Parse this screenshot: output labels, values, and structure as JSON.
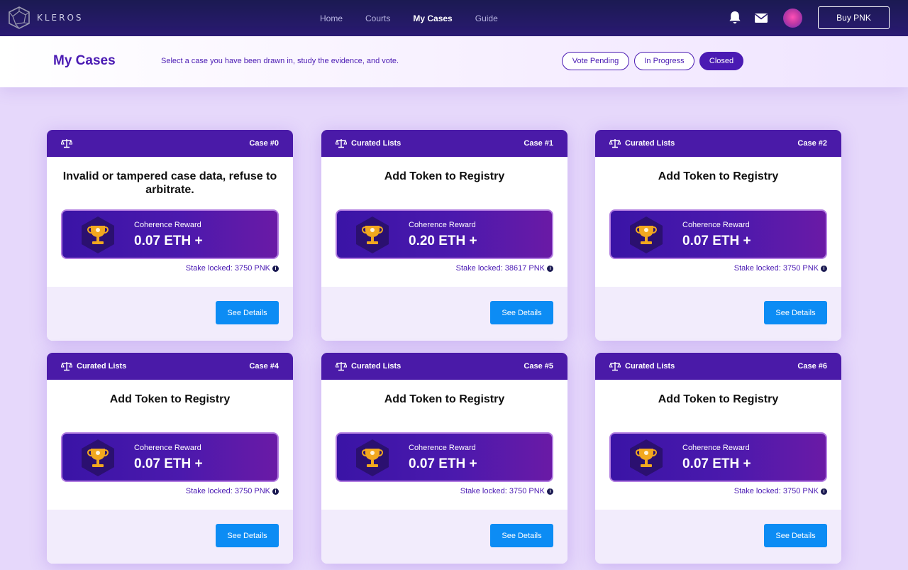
{
  "nav": {
    "logo_text": "KLEROS",
    "links": [
      "Home",
      "Courts",
      "My Cases",
      "Guide"
    ],
    "active": "My Cases",
    "buy_label": "Buy PNK"
  },
  "header": {
    "title": "My Cases",
    "subtitle": "Select a case you have been drawn in, study the evidence, and vote.",
    "filters": [
      "Vote Pending",
      "In Progress",
      "Closed"
    ],
    "active_filter": "Closed"
  },
  "colors": {
    "brand": "#4a1ab3",
    "nav_bg": "#1b1a52",
    "button": "#0c8cf4",
    "trophy": "#f2a81f"
  },
  "cards": [
    {
      "category": "",
      "case": "Case #0",
      "title": "Invalid or tampered case data, refuse to arbitrate.",
      "reward_label": "Coherence Reward",
      "reward": "0.07 ETH +",
      "stake": "Stake locked: 3750 PNK",
      "button": "See Details"
    },
    {
      "category": "Curated Lists",
      "case": "Case #1",
      "title": "Add Token to Registry",
      "reward_label": "Coherence Reward",
      "reward": "0.20 ETH +",
      "stake": "Stake locked: 38617 PNK",
      "button": "See Details"
    },
    {
      "category": "Curated Lists",
      "case": "Case #2",
      "title": "Add Token to Registry",
      "reward_label": "Coherence Reward",
      "reward": "0.07 ETH +",
      "stake": "Stake locked: 3750 PNK",
      "button": "See Details"
    },
    {
      "category": "Curated Lists",
      "case": "Case #4",
      "title": "Add Token to Registry",
      "reward_label": "Coherence Reward",
      "reward": "0.07 ETH +",
      "stake": "Stake locked: 3750 PNK",
      "button": "See Details"
    },
    {
      "category": "Curated Lists",
      "case": "Case #5",
      "title": "Add Token to Registry",
      "reward_label": "Coherence Reward",
      "reward": "0.07 ETH +",
      "stake": "Stake locked: 3750 PNK",
      "button": "See Details"
    },
    {
      "category": "Curated Lists",
      "case": "Case #6",
      "title": "Add Token to Registry",
      "reward_label": "Coherence Reward",
      "reward": "0.07 ETH +",
      "stake": "Stake locked: 3750 PNK",
      "button": "See Details"
    }
  ],
  "icons": {
    "logo": "kleros-logo-icon",
    "bell": "bell-icon",
    "mail": "mail-icon",
    "scale": "scale-icon",
    "trophy": "trophy-icon",
    "info": "info-icon"
  }
}
